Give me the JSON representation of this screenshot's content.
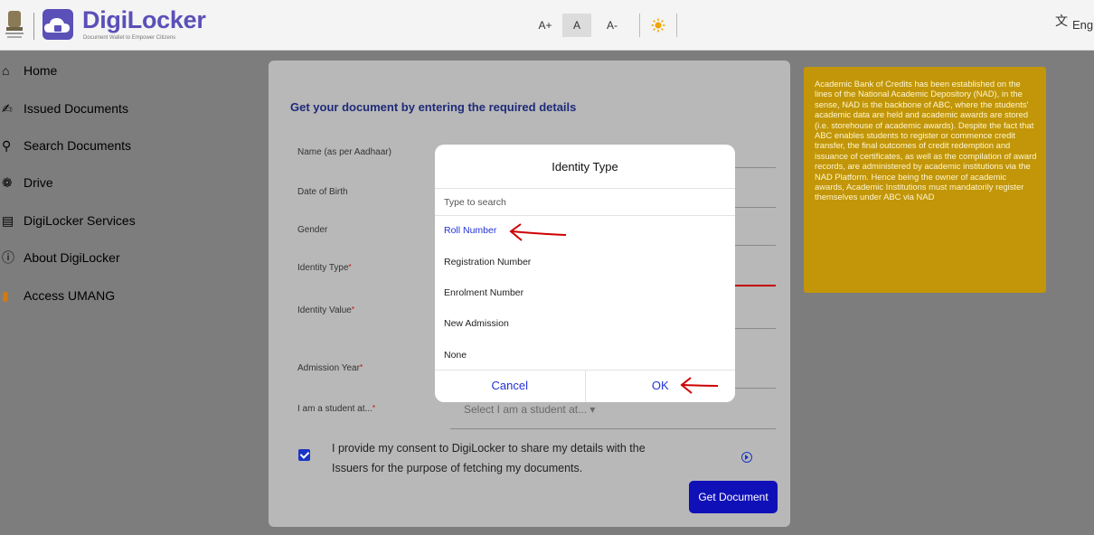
{
  "header": {
    "brand_title": "DigiLocker",
    "brand_tagline": "Document Wallet to Empower Citizens",
    "font_increase": "A+",
    "font_normal": "A",
    "font_decrease": "A-",
    "language": "Engli",
    "icons": [
      "national-emblem",
      "cloud-logo",
      "sun-icon",
      "language-icon"
    ]
  },
  "sidebar": {
    "items": [
      {
        "label": "Home",
        "icon": "home-icon"
      },
      {
        "label": "Issued Documents",
        "icon": "issued-documents-icon"
      },
      {
        "label": "Search Documents",
        "icon": "search-icon"
      },
      {
        "label": "Drive",
        "icon": "drive-icon"
      },
      {
        "label": "DigiLocker Services",
        "icon": "services-icon"
      },
      {
        "label": "About DigiLocker",
        "icon": "info-icon"
      },
      {
        "label": "Access UMANG",
        "icon": "umang-icon"
      }
    ]
  },
  "form": {
    "title": "Get your document by entering the required details",
    "fields": {
      "name": "Name (as per Aadhaar)",
      "dob": "Date of Birth",
      "gender": "Gender",
      "identity_type": "Identity Type",
      "identity_value": "Identity Value",
      "admission_year": "Admission Year",
      "student_at": "I am a student at..."
    },
    "required_mark": "*",
    "student_placeholder": "Select I am a student at... ▾",
    "consent_text": "I provide my consent to DigiLocker to share my details with the Issuers for the purpose of fetching my documents.",
    "submit_label": "Get Document"
  },
  "info_box": {
    "text": "Academic Bank of Credits has been established on the lines of the National Academic Depository (NAD), in the sense, NAD is the backbone of ABC, where the students' academic data are held and academic awards are stored (i.e. storehouse of academic awards). Despite the fact that ABC enables students to register or commence credit transfer, the final outcomes of credit redemption and issuance of certificates, as well as the compilation of award records, are administered by academic institutions via the NAD Platform. Hence being the owner of academic awards, Academic Institutions must mandatorily register themselves under ABC via NAD",
    "color": "#c29608"
  },
  "modal": {
    "title": "Identity Type",
    "search_placeholder": "Type to search",
    "options": [
      "Roll Number",
      "Registration Number",
      "Enrolment Number",
      "New Admission",
      "None"
    ],
    "selected": "Roll Number",
    "cancel_label": "Cancel",
    "ok_label": "OK",
    "accent_color": "#2233d6"
  }
}
